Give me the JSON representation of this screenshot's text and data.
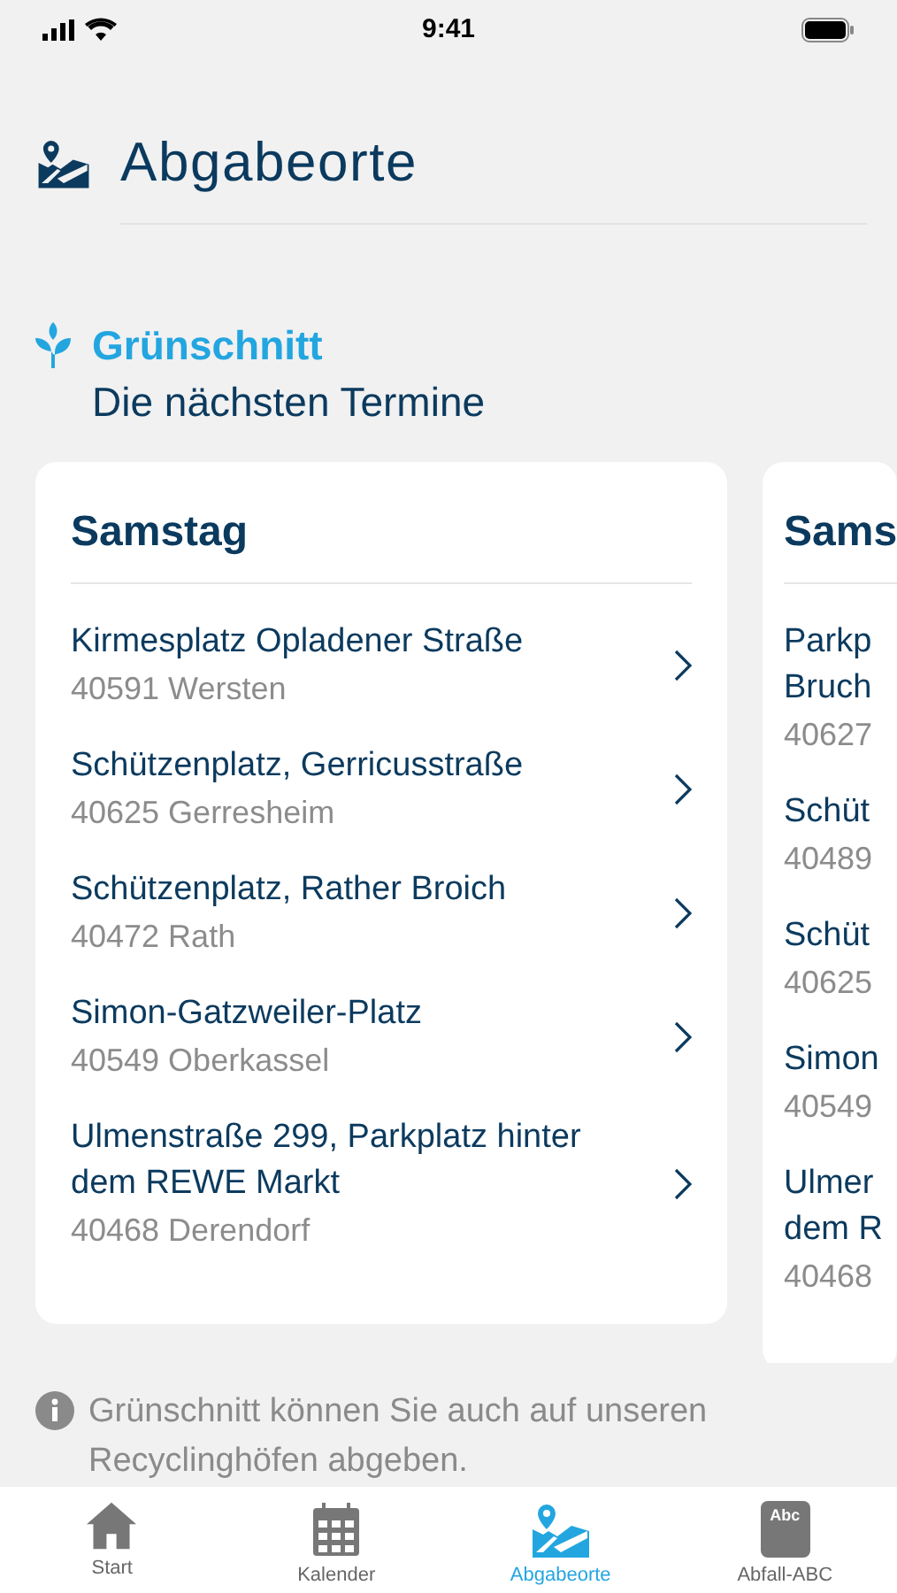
{
  "status_bar": {
    "time": "9:41"
  },
  "header": {
    "title": "Abgabeorte"
  },
  "section": {
    "title": "Grünschnitt",
    "subtitle": "Die nächsten Termine"
  },
  "cards": [
    {
      "day": "Samstag",
      "locations": [
        {
          "name": "Kirmesplatz Opladener Straße",
          "place": "40591 Wersten"
        },
        {
          "name": "Schützenplatz, Gerricusstraße",
          "place": "40625 Gerresheim"
        },
        {
          "name": "Schützenplatz, Rather Broich",
          "place": "40472 Rath"
        },
        {
          "name": "Simon-Gatzweiler-Platz",
          "place": "40549 Oberkassel"
        },
        {
          "name": "Ulmenstraße 299, Parkplatz hinter dem REWE Markt",
          "place": "40468 Derendorf"
        }
      ]
    },
    {
      "day": "Sams",
      "locations": [
        {
          "name_lines": [
            "Parkp",
            "Bruch"
          ],
          "place": "40627"
        },
        {
          "name_lines": [
            "Schüt"
          ],
          "place": "40489"
        },
        {
          "name_lines": [
            "Schüt"
          ],
          "place": "40625"
        },
        {
          "name_lines": [
            "Simon"
          ],
          "place": "40549"
        },
        {
          "name_lines": [
            "Ulmer",
            "dem R"
          ],
          "place": "40468"
        }
      ]
    }
  ],
  "note": "Grünschnitt können Sie auch auf unseren Recyclinghöfen abgeben.",
  "tabs": [
    {
      "label": "Start",
      "kind": "home",
      "selected": false
    },
    {
      "label": "Kalender",
      "kind": "calendar",
      "selected": false
    },
    {
      "label": "Abgabeorte",
      "kind": "map",
      "selected": true
    },
    {
      "label": "Abfall-ABC",
      "kind": "book",
      "icon_text": "Abc",
      "selected": false
    }
  ]
}
